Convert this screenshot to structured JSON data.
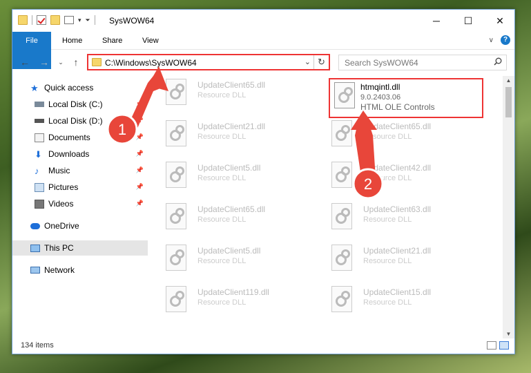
{
  "window": {
    "title": "SysWOW64"
  },
  "ribbon": {
    "file": "File",
    "home": "Home",
    "share": "Share",
    "view": "View"
  },
  "address": {
    "path": "C:\\Windows\\SysWOW64"
  },
  "search": {
    "placeholder": "Search SysWOW64"
  },
  "sidebar": {
    "items": [
      {
        "label": "Quick access"
      },
      {
        "label": "Local Disk (C:)"
      },
      {
        "label": "Local Disk (D:)"
      },
      {
        "label": "Documents"
      },
      {
        "label": "Downloads"
      },
      {
        "label": "Music"
      },
      {
        "label": "Pictures"
      },
      {
        "label": "Videos"
      },
      {
        "label": "OneDrive"
      },
      {
        "label": "This PC"
      },
      {
        "label": "Network"
      }
    ]
  },
  "files": {
    "highlighted": {
      "name": "htmqintl.dll",
      "version": "9.0.2403.06",
      "desc": "HTML OLE Controls"
    },
    "left": [
      {
        "name": "UpdateClient65.dll",
        "desc": "Resource DLL"
      },
      {
        "name": "UpdateClient21.dll",
        "desc": "Resource DLL"
      },
      {
        "name": "UpdateClient5.dll",
        "desc": "Resource DLL"
      },
      {
        "name": "UpdateClient65.dll",
        "desc": "Resource DLL"
      },
      {
        "name": "UpdateClient5.dll",
        "desc": "Resource DLL"
      },
      {
        "name": "UpdateClient119.dll",
        "desc": "Resource DLL"
      }
    ],
    "right": [
      {
        "name": "UpdateClient65.dll",
        "desc": "Resource DLL"
      },
      {
        "name": "UpdateClient42.dll",
        "desc": "Resource DLL"
      },
      {
        "name": "UpdateClient63.dll",
        "desc": "Resource DLL"
      },
      {
        "name": "UpdateClient21.dll",
        "desc": "Resource DLL"
      },
      {
        "name": "UpdateClient15.dll",
        "desc": "Resource DLL"
      }
    ]
  },
  "status": {
    "count": "134 items"
  },
  "annotations": {
    "step1": "1",
    "step2": "2",
    "color": "#e8463a"
  }
}
